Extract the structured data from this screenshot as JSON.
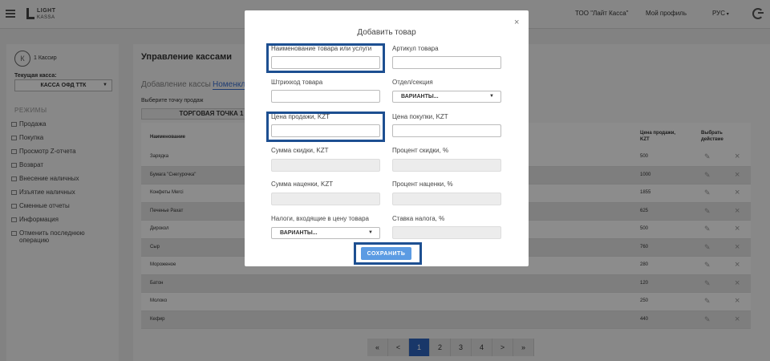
{
  "topbar": {
    "logo_line1": "LIGHT",
    "logo_line2": "KASSA",
    "org": "ТОО \"Лайт Касса\"",
    "profile": "Мой профиль",
    "language": "РУС"
  },
  "sidebar": {
    "avatar_initial": "К",
    "cashier": "1 Кассир",
    "current_label": "Текущая касса:",
    "current_value": "КАССА ОФД ТТК",
    "modes_title": "РЕЖИМЫ",
    "items": [
      {
        "label": "Продажа"
      },
      {
        "label": "Покупка"
      },
      {
        "label": "Просмотр Z-отчета"
      },
      {
        "label": "Возврат"
      },
      {
        "label": "Внесение наличных"
      },
      {
        "label": "Изъятие наличных"
      },
      {
        "label": "Сменные отчеты"
      },
      {
        "label": "Информация"
      },
      {
        "label": "Отменить последнюю операцию"
      }
    ]
  },
  "main": {
    "title": "Управление кассами",
    "tabs": [
      "Добавление кассы",
      "Номенкла"
    ],
    "point_label": "Выберите точку продаж",
    "point_value": "ТОРГОВАЯ ТОЧКА 1",
    "columns": {
      "name": "Наименование",
      "price_line1": "Цена продажи,",
      "price_line2": "KZT",
      "action_line1": "Выбрать",
      "action_line2": "действие"
    },
    "rows": [
      {
        "name": "Зарядка",
        "price": "500"
      },
      {
        "name": "Бумага \"Снегурочка\"",
        "price": "1000"
      },
      {
        "name": "Конфеты Merci",
        "price": "1855"
      },
      {
        "name": "Печенье Рахат",
        "price": "625"
      },
      {
        "name": "Дирокол",
        "price": "500"
      },
      {
        "name": "Сыр",
        "price": "760"
      },
      {
        "name": "Мороженое",
        "price": "280"
      },
      {
        "name": "Батон",
        "price": "120"
      },
      {
        "name": "Молоко",
        "price": "250"
      },
      {
        "name": "Кефир",
        "price": "440"
      }
    ],
    "pagination": [
      "«",
      "<",
      "1",
      "2",
      "3",
      "4",
      ">",
      "»"
    ],
    "current_page": "1"
  },
  "modal": {
    "title": "Добавить товар",
    "close": "×",
    "fields": {
      "product_name": "Наименование товара или услуги",
      "article": "Артикул товара",
      "barcode": "Штрихкод товара",
      "department": "Отдел/секция",
      "department_value": "ВАРИАНТЫ...",
      "sale_price": "Цена продажи, KZT",
      "purchase_price": "Цена покупки, KZT",
      "discount_sum": "Сумма скидки, KZT",
      "discount_percent": "Процент скидки, %",
      "markup_sum": "Сумма наценки, KZT",
      "markup_percent": "Процент наценки, %",
      "taxes": "Налоги, входящие в цену товара",
      "taxes_value": "ВАРИАНТЫ...",
      "tax_rate": "Ставка налога, %"
    },
    "save_label": "СОХРАНИТЬ"
  }
}
